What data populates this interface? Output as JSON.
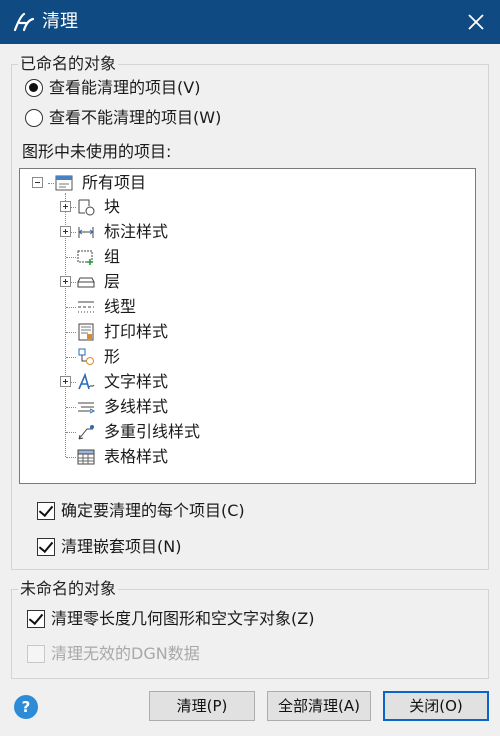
{
  "window": {
    "title": "清理"
  },
  "named_group": {
    "title": "已命名的对象",
    "radio_view_purgeable": "查看能清理的项目(V)",
    "radio_view_nonpurgeable": "查看不能清理的项目(W)",
    "radio_selected": "purgeable",
    "tree_caption": "图形中未使用的项目:",
    "tree": {
      "root": "所有项目",
      "items": [
        {
          "label": "块",
          "icon": "block-icon",
          "expandable": true
        },
        {
          "label": "标注样式",
          "icon": "dimension-style-icon",
          "expandable": true
        },
        {
          "label": "组",
          "icon": "group-icon",
          "expandable": false
        },
        {
          "label": "层",
          "icon": "layer-icon",
          "expandable": true
        },
        {
          "label": "线型",
          "icon": "linetype-icon",
          "expandable": false
        },
        {
          "label": "打印样式",
          "icon": "plot-style-icon",
          "expandable": false
        },
        {
          "label": "形",
          "icon": "shape-icon",
          "expandable": false
        },
        {
          "label": "文字样式",
          "icon": "text-style-icon",
          "expandable": true
        },
        {
          "label": "多线样式",
          "icon": "multiline-style-icon",
          "expandable": false
        },
        {
          "label": "多重引线样式",
          "icon": "multileader-style-icon",
          "expandable": false
        },
        {
          "label": "表格样式",
          "icon": "table-style-icon",
          "expandable": false
        }
      ]
    },
    "confirm_each": {
      "label": "确定要清理的每个项目(C)",
      "checked": true
    },
    "purge_nested": {
      "label": "清理嵌套项目(N)",
      "checked": true
    }
  },
  "unnamed_group": {
    "title": "未命名的对象",
    "purge_zero_length": {
      "label": "清理零长度几何图形和空文字对象(Z)",
      "checked": true
    },
    "purge_invalid_dgn": {
      "label": "清理无效的DGN数据",
      "checked": false,
      "disabled": true
    }
  },
  "buttons": {
    "help": "?",
    "purge": "清理(P)",
    "purge_all": "全部清理(A)",
    "close": "关闭(O)"
  },
  "colors": {
    "titlebar": "#0f4a82",
    "accent": "#0a64c9",
    "help": "#2e8bd6"
  }
}
